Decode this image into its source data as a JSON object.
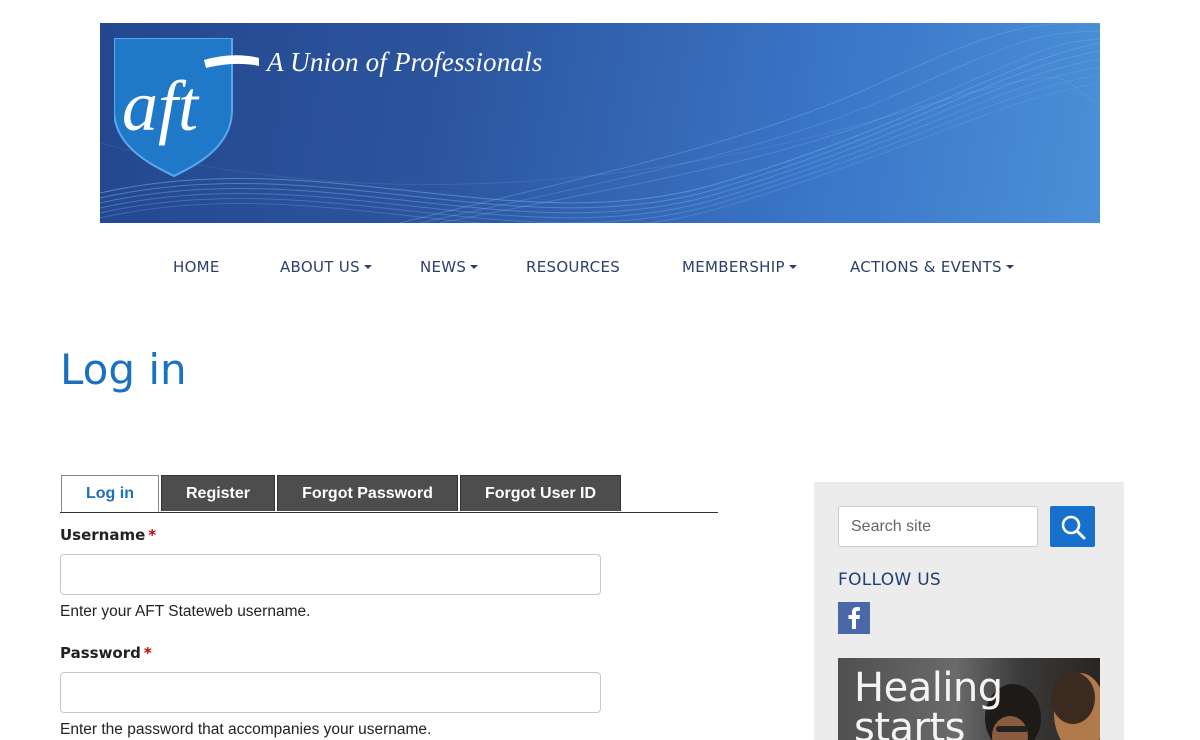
{
  "banner": {
    "tagline": "A Union of Professionals",
    "logo_text": "aft"
  },
  "nav": [
    {
      "label": "HOME",
      "dropdown": false
    },
    {
      "label": "ABOUT US",
      "dropdown": true
    },
    {
      "label": "NEWS",
      "dropdown": true
    },
    {
      "label": "RESOURCES",
      "dropdown": false
    },
    {
      "label": "MEMBERSHIP",
      "dropdown": true
    },
    {
      "label": "ACTIONS & EVENTS",
      "dropdown": true
    }
  ],
  "page": {
    "title": "Log in"
  },
  "tabs": [
    {
      "label": "Log in",
      "active": true
    },
    {
      "label": "Register",
      "active": false
    },
    {
      "label": "Forgot Password",
      "active": false
    },
    {
      "label": "Forgot User ID",
      "active": false
    }
  ],
  "form": {
    "username": {
      "label": "Username",
      "required_mark": "*",
      "value": "",
      "help": "Enter your AFT Stateweb username."
    },
    "password": {
      "label": "Password",
      "required_mark": "*",
      "value": "",
      "help": "Enter the password that accompanies your username."
    }
  },
  "sidebar": {
    "search": {
      "placeholder": "Search site",
      "button_icon": "search-icon"
    },
    "follow_heading": "FOLLOW US",
    "social": [
      {
        "icon": "facebook-icon"
      }
    ],
    "promo_text": "Healing\nstarts"
  },
  "colors": {
    "accent": "#1b70c0",
    "nav_text": "#2c3e6b",
    "tab_dark": "#4d4d4d",
    "search_button": "#1670cc",
    "facebook": "#4a67a8",
    "sidebar_bg": "#ececec",
    "banner_dark": "#23478e",
    "banner_light": "#4a90d8"
  }
}
